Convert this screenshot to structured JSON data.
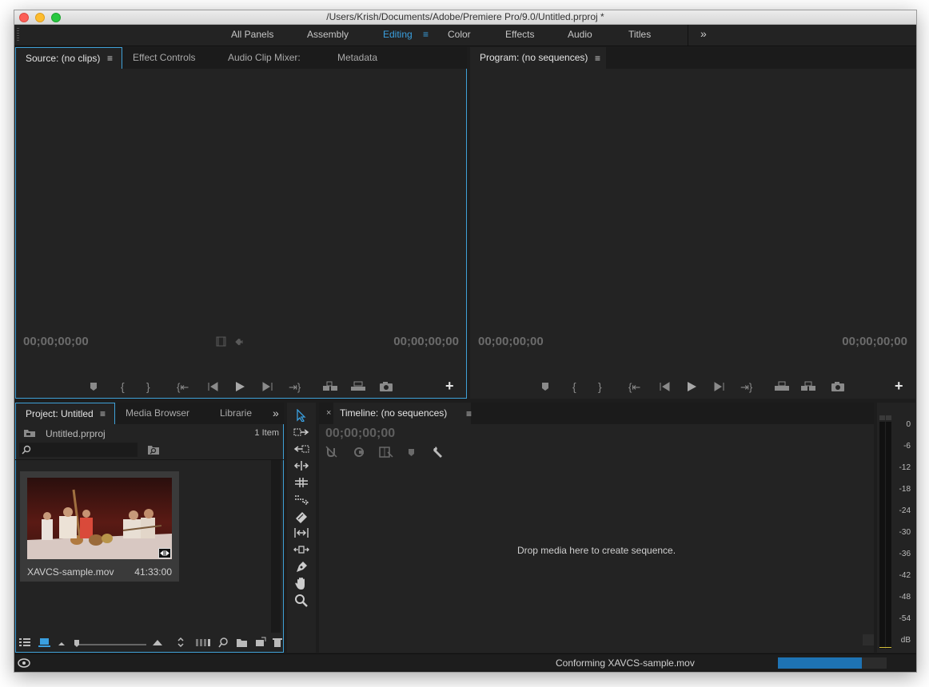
{
  "window": {
    "title": "/Users/Krish/Documents/Adobe/Premiere Pro/9.0/Untitled.prproj *"
  },
  "workspaces": {
    "items": [
      "All Panels",
      "Assembly",
      "Editing",
      "Color",
      "Effects",
      "Audio",
      "Titles"
    ],
    "active": "Editing",
    "menu_icon": "≡",
    "more_icon": "»"
  },
  "source_panel": {
    "tabs": [
      "Source: (no clips)",
      "Effect Controls",
      "Audio Clip Mixer:",
      "Metadata"
    ],
    "tab_menu_icon": "≡",
    "timecode_in": "00;00;00;00",
    "timecode_out": "00;00;00;00"
  },
  "program_panel": {
    "tab": "Program: (no sequences)",
    "tab_menu_icon": "≡",
    "timecode_in": "00;00;00;00",
    "timecode_out": "00;00;00;00"
  },
  "project_panel": {
    "tabs": [
      "Project: Untitled",
      "Media Browser",
      "Librarie"
    ],
    "tab_menu_icon": "≡",
    "more_icon": "»",
    "file_name": "Untitled.prproj",
    "item_count": "1 Item",
    "search_placeholder": "",
    "clip": {
      "name": "XAVCS-sample.mov",
      "duration": "41:33:00"
    }
  },
  "timeline_panel": {
    "close_icon": "×",
    "tab": "Timeline: (no sequences)",
    "tab_menu_icon": "≡",
    "timecode": "00;00;00;00",
    "drop_message": "Drop media here to create sequence."
  },
  "audio_meter": {
    "scale": [
      "0",
      "-6",
      "-12",
      "-18",
      "-24",
      "-30",
      "-36",
      "-42",
      "-48",
      "-54",
      "dB"
    ]
  },
  "status_bar": {
    "message": "Conforming XAVCS-sample.mov",
    "progress": 0.77,
    "progress_color": "#1e73b4"
  },
  "colors": {
    "accent": "#3aa0e0",
    "panel_bg": "#232323",
    "focus_border": "#3fa1d8"
  }
}
